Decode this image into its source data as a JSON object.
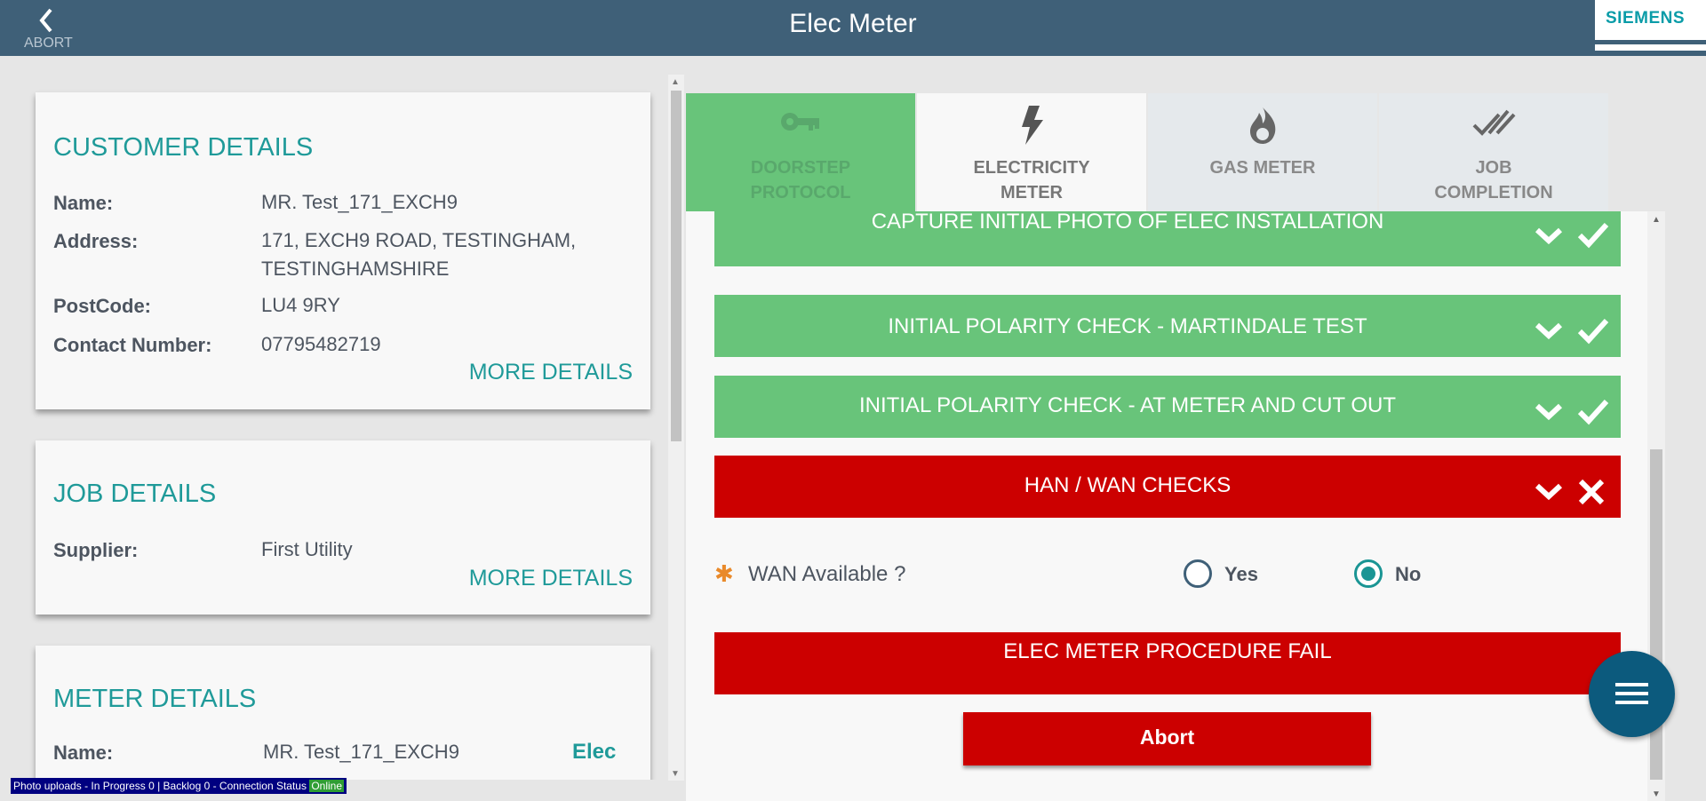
{
  "header": {
    "title": "Elec Meter",
    "back_label": "ABORT",
    "logo": "SIEMENS"
  },
  "customer": {
    "title": "CUSTOMER DETAILS",
    "name_label": "Name:",
    "name": "MR. Test_171_EXCH9",
    "address_label": "Address:",
    "address_line1": "171, EXCH9 ROAD, TESTINGHAM,",
    "address_line2": "TESTINGHAMSHIRE",
    "postcode_label": "PostCode:",
    "postcode": "LU4 9RY",
    "contact_label": "Contact Number:",
    "contact": "07795482719",
    "more": "MORE DETAILS"
  },
  "job": {
    "title": "JOB DETAILS",
    "supplier_label": "Supplier:",
    "supplier": "First Utility",
    "more": "MORE DETAILS"
  },
  "meter": {
    "title": "METER DETAILS",
    "name_label": "Name:",
    "name": "MR. Test_171_EXCH9",
    "tag": "Elec"
  },
  "tabs": [
    {
      "line1": "DOORSTEP",
      "line2": "PROTOCOL",
      "icon": "key-icon"
    },
    {
      "line1": "ELECTRICITY",
      "line2": "METER",
      "icon": "lightning-icon"
    },
    {
      "line1": "GAS METER",
      "line2": "",
      "icon": "flame-icon"
    },
    {
      "line1": "JOB",
      "line2": "COMPLETION",
      "icon": "double-check-icon"
    }
  ],
  "steps": [
    {
      "label": "CAPTURE INITIAL PHOTO OF ELEC INSTALLATION",
      "status": "pass"
    },
    {
      "label": "INITIAL POLARITY CHECK - MARTINDALE TEST",
      "status": "pass"
    },
    {
      "label": "INITIAL POLARITY CHECK - AT METER AND CUT OUT",
      "status": "pass"
    },
    {
      "label": "HAN / WAN CHECKS",
      "status": "fail"
    }
  ],
  "question": {
    "label": "WAN Available ?",
    "required_mark": "✱",
    "options": [
      "Yes",
      "No"
    ],
    "selected": "No"
  },
  "fail_banner": "ELEC METER PROCEDURE FAIL",
  "abort_button": "Abort",
  "status_bar": {
    "text": "Photo uploads - In Progress 0 | Backlog 0 - Connection Status ",
    "connection": "Online"
  },
  "colors": {
    "header": "#3f6078",
    "accent": "#1f9a99",
    "pass": "#68c47a",
    "fail": "#cc0000",
    "fab": "#0c5a7d"
  }
}
